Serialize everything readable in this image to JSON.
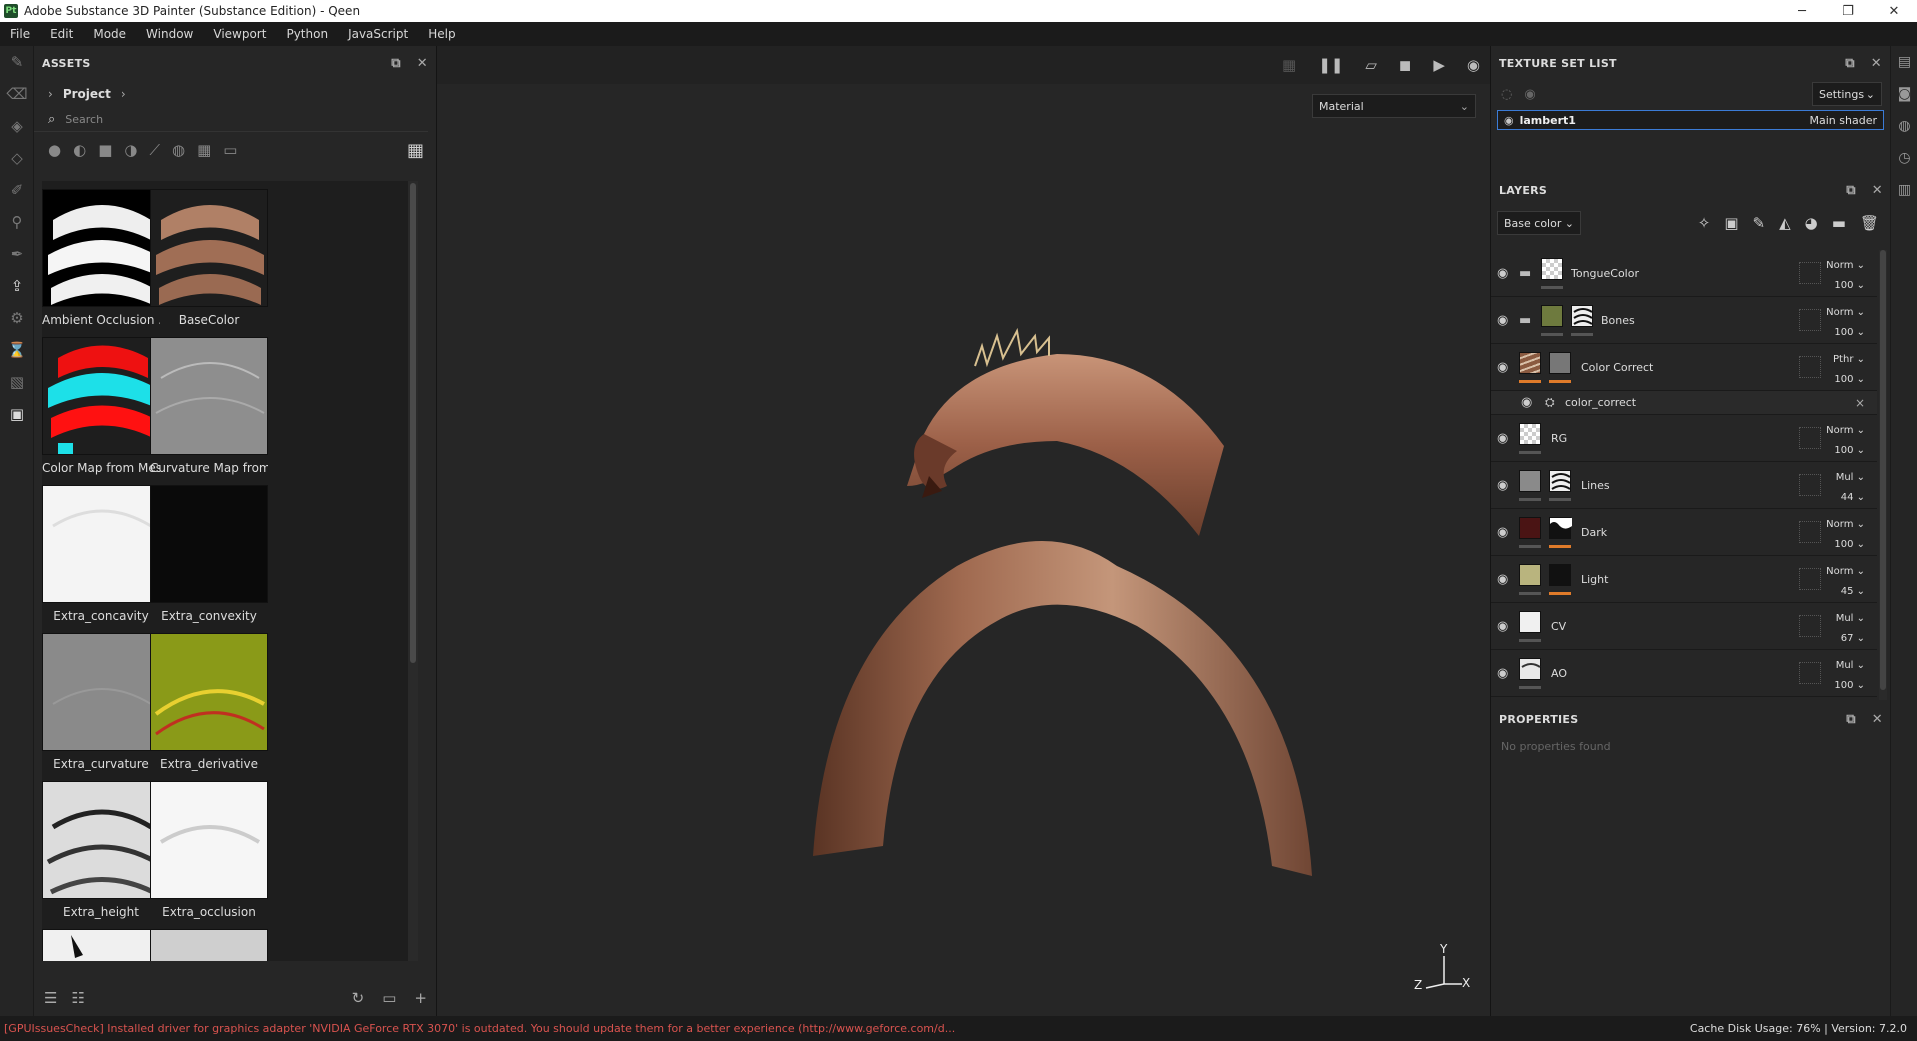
{
  "window": {
    "title": "Adobe Substance 3D Painter (Substance Edition) - Qeen",
    "logo": "Pt"
  },
  "menu": [
    "File",
    "Edit",
    "Mode",
    "Window",
    "Viewport",
    "Python",
    "JavaScript",
    "Help"
  ],
  "assets": {
    "title": "ASSETS",
    "breadcrumb": "Project",
    "search_placeholder": "Search",
    "items": [
      {
        "label": "Ambient Occlusion ...",
        "style": "ao"
      },
      {
        "label": "BaseColor",
        "style": "base"
      },
      {
        "label": "Color Map from Mes...",
        "style": "colormap"
      },
      {
        "label": "Curvature Map from...",
        "style": "curv"
      },
      {
        "label": "Extra_concavity",
        "style": "concav"
      },
      {
        "label": "Extra_convexity",
        "style": "convex"
      },
      {
        "label": "Extra_curvature",
        "style": "excurv"
      },
      {
        "label": "Extra_derivative",
        "style": "deriv"
      },
      {
        "label": "Extra_height",
        "style": "height"
      },
      {
        "label": "Extra_occlusion",
        "style": "occl"
      },
      {
        "label": "",
        "style": "partial1"
      },
      {
        "label": "",
        "style": "partial2"
      }
    ]
  },
  "viewport": {
    "material_mode": "Material",
    "axis": {
      "y": "Y",
      "z": "Z",
      "x": "X"
    }
  },
  "texture_set_list": {
    "title": "TEXTURE SET LIST",
    "settings_label": "Settings",
    "sets": [
      {
        "name": "lambert1",
        "shader": "Main shader"
      }
    ]
  },
  "layers": {
    "title": "LAYERS",
    "channel": "Base color",
    "items": [
      {
        "name": "TongueColor",
        "blend": "Norm",
        "opacity": "100",
        "folder": true,
        "swatch": "#d8d8d8",
        "mask": "",
        "bar": ""
      },
      {
        "name": "Bones",
        "blend": "Norm",
        "opacity": "100",
        "folder": true,
        "swatch": "#6e7a3e",
        "mask": "#eeeeee",
        "bar": ""
      },
      {
        "name": "Color Correct",
        "blend": "Pthr",
        "opacity": "100",
        "folder": false,
        "swatch": "#8a5a40",
        "mask": "#777777",
        "bar": "#e07b2a"
      },
      {
        "name": "RG",
        "blend": "Norm",
        "opacity": "100",
        "folder": false,
        "swatch": "#cfcfcf",
        "mask": "",
        "bar": ""
      },
      {
        "name": "Lines",
        "blend": "Mul",
        "opacity": "44",
        "folder": false,
        "swatch": "#8a8a8a",
        "mask": "#eeeeee",
        "bar": ""
      },
      {
        "name": "Dark",
        "blend": "Norm",
        "opacity": "100",
        "folder": false,
        "swatch": "#4a1414",
        "mask": "#111111",
        "bar": "#e07b2a"
      },
      {
        "name": "Light",
        "blend": "Norm",
        "opacity": "45",
        "folder": false,
        "swatch": "#b9b47e",
        "mask": "#111111",
        "bar": "#e07b2a"
      },
      {
        "name": "CV",
        "blend": "Mul",
        "opacity": "67",
        "folder": false,
        "swatch": "#f0f0f0",
        "mask": "",
        "bar": ""
      },
      {
        "name": "AO",
        "blend": "Mul",
        "opacity": "100",
        "folder": false,
        "swatch": "#e8e8e8",
        "mask": "",
        "bar": ""
      }
    ],
    "effect": {
      "name": "color_correct",
      "close": "×"
    }
  },
  "properties": {
    "title": "PROPERTIES",
    "empty": "No properties found"
  },
  "status": {
    "error": "[GPUIssuesCheck] Installed driver for graphics adapter 'NVIDIA GeForce RTX 3070' is outdated. You should update them for a better experience (http://www.geforce.com/d...",
    "info": "Cache Disk Usage:  76% | Version: 7.2.0"
  },
  "colors": {
    "accent": "#3b7bd6",
    "error": "#d9534f",
    "bar": "#e07b2a"
  }
}
